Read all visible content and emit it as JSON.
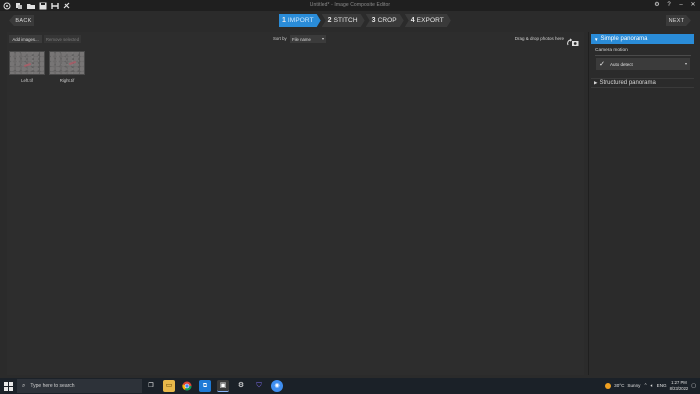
{
  "window": {
    "title": "Untitled* - Image Composite Editor",
    "icons": [
      "app-icon",
      "new-icon",
      "open-icon",
      "save-icon",
      "export-icon",
      "settings-icon"
    ],
    "right_icons": [
      "gear-icon",
      "help-icon",
      "minimize-icon",
      "close-icon"
    ]
  },
  "nav": {
    "back_label": "BACK",
    "next_label": "NEXT",
    "steps": [
      {
        "num": "1",
        "label": "IMPORT",
        "active": true
      },
      {
        "num": "2",
        "label": "STITCH",
        "active": false
      },
      {
        "num": "3",
        "label": "CROP",
        "active": false
      },
      {
        "num": "4",
        "label": "EXPORT",
        "active": false
      }
    ]
  },
  "import_toolbar": {
    "add_images_label": "Add images...",
    "remove_selected_label": "Remove selected",
    "sort_by_label": "Sort by",
    "sort_value": "File name",
    "drag_drop_label": "Drag & drop photos here"
  },
  "thumbnails": [
    {
      "caption": "Left.tif"
    },
    {
      "caption": "Right.tif"
    }
  ],
  "right_panel": {
    "simple_panorama_label": "Simple panorama",
    "camera_motion_label": "Camera motion",
    "camera_motion_value": "Auto detect",
    "structured_panorama_label": "Structured panorama"
  },
  "taskbar": {
    "search_placeholder": "Type here to search",
    "weather_temp": "30°C",
    "weather_text": "Sunny",
    "language": "ENG",
    "time": "1:27 PM",
    "date": "8/23/2022"
  },
  "colors": {
    "accent": "#2a8cd8",
    "background": "#2b2b2b",
    "taskbar": "#1b2128"
  }
}
